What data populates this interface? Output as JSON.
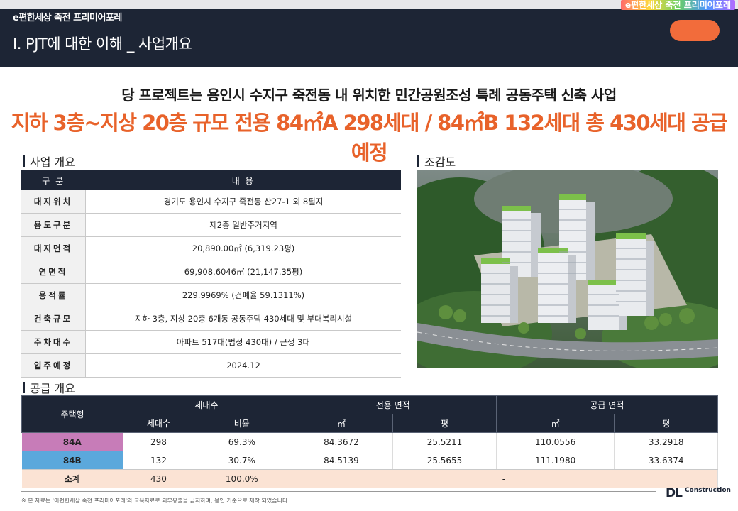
{
  "header": {
    "brand": "e편한세상 죽전 프리미어포레",
    "rainbow_brand": "e편한세상 죽전 프리미어포레",
    "section_title": "Ⅰ. PJT에 대한 이해 _ 사업개요"
  },
  "headline": {
    "line1": "당 프로젝트는 용인시 수지구 죽전동 내 위치한 민간공원조성 특례 공동주택 신축 사업",
    "line2": "지하 3층~지상 20층 규모 전용 84㎡A 298세대 / 84㎡B 132세대 총 430세대 공급 예정"
  },
  "business": {
    "title": "사업 개요",
    "col_label": "구 분",
    "col_content": "내 용",
    "rows": [
      {
        "label": "대지위치",
        "value": "경기도 용인시 수지구 죽전동 산27-1 외 8필지"
      },
      {
        "label": "용도구분",
        "value": "제2종 일반주거지역"
      },
      {
        "label": "대지면적",
        "value": "20,890.00㎡ (6,319.23평)"
      },
      {
        "label": "연면적",
        "value": "69,908.6046㎡ (21,147.35평)"
      },
      {
        "label": "용적률",
        "value": "229.9969% (건폐율 59.1311%)"
      },
      {
        "label": "건축규모",
        "value": "지하 3층, 지상 20층 6개동 공동주택 430세대 및 부대복리시설"
      },
      {
        "label": "주차대수",
        "value": "아파트 517대(법정 430대) / 근생 3대"
      },
      {
        "label": "입주예정",
        "value": "2024.12"
      }
    ]
  },
  "aerial": {
    "title": "조감도"
  },
  "supply": {
    "title": "공급 개요",
    "h_type": "주택형",
    "h_units": "세대수",
    "h_exclusive": "전용 면적",
    "h_supply": "공급 면적",
    "h_count": "세대수",
    "h_ratio": "비율",
    "h_m2": "㎡",
    "h_m2b": "㎡",
    "h_py": "평",
    "h_pyb": "평",
    "rows": [
      {
        "type": "84A",
        "count": "298",
        "ratio": "69.3%",
        "ex_m2": "84.3672",
        "ex_py": "25.5211",
        "sup_m2": "110.0556",
        "sup_py": "33.2918"
      },
      {
        "type": "84B",
        "count": "132",
        "ratio": "30.7%",
        "ex_m2": "84.5139",
        "ex_py": "25.5655",
        "sup_m2": "111.1980",
        "sup_py": "33.6374"
      }
    ],
    "total": {
      "type": "소계",
      "count": "430",
      "ratio": "100.0%",
      "dash": "-"
    }
  },
  "footer": {
    "note": "※ 본 자료는 '이편한세상 죽전 프리미어포레'의 교육자료로 외부유출을 금지하며, 용인 기준으로 제작 되었습니다.",
    "logo_mark": "DL",
    "logo_word": "Construction"
  }
}
